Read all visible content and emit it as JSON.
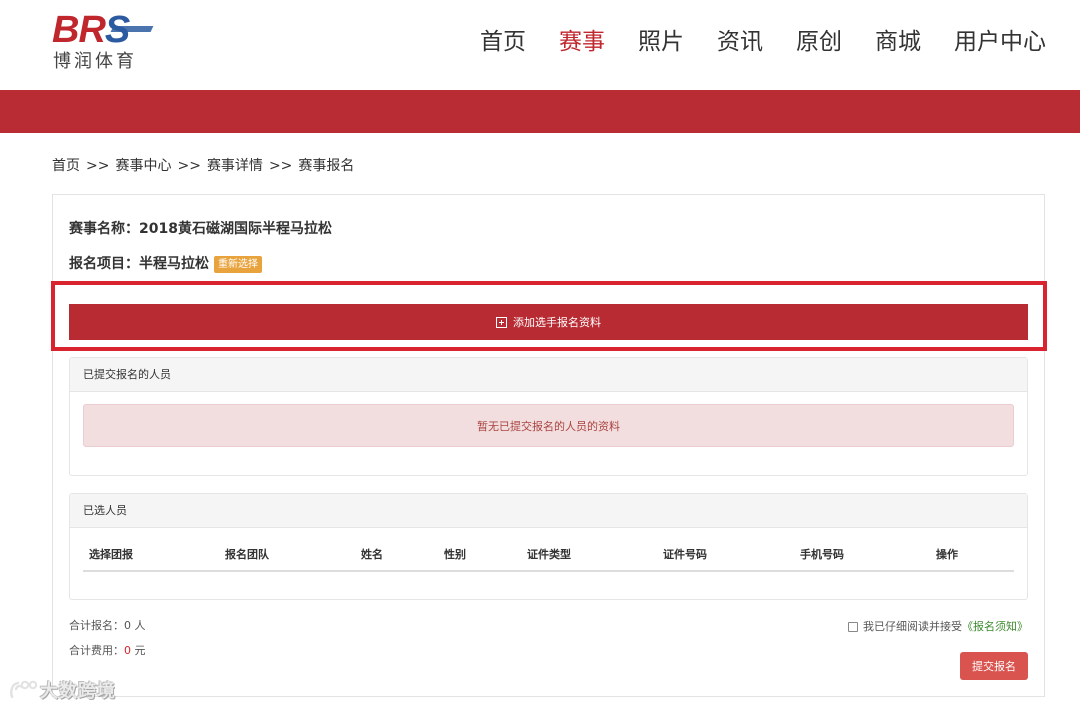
{
  "logo": {
    "letter_b": "B",
    "letter_r": "R",
    "letter_s": "S",
    "subtitle": "博润体育",
    "brand_red": "#c0272d",
    "brand_blue": "#2c5aa0"
  },
  "nav": {
    "items": [
      {
        "label": "首页",
        "active": false
      },
      {
        "label": "赛事",
        "active": true
      },
      {
        "label": "照片",
        "active": false
      },
      {
        "label": "资讯",
        "active": false
      },
      {
        "label": "原创",
        "active": false
      },
      {
        "label": "商城",
        "active": false
      },
      {
        "label": "用户中心",
        "active": false
      }
    ]
  },
  "breadcrumb": {
    "items": [
      "首页",
      "赛事中心",
      "赛事详情",
      "赛事报名"
    ],
    "separator": ">>"
  },
  "event": {
    "name_label": "赛事名称：",
    "name_value": "2018黄石磁湖国际半程马拉松",
    "item_label": "报名项目：",
    "item_value": "半程马拉松",
    "reselect_label": "重新选择"
  },
  "add_button": {
    "label": "添加选手报名资料",
    "icon": "plus-square-icon"
  },
  "submitted_panel": {
    "title": "已提交报名的人员",
    "empty_message": "暂无已提交报名的人员的资料"
  },
  "selected_panel": {
    "title": "已选人员",
    "columns": [
      "选择团报",
      "报名团队",
      "姓名",
      "性别",
      "证件类型",
      "证件号码",
      "手机号码",
      "操作"
    ]
  },
  "totals": {
    "count_label": "合计报名：",
    "count_value": "0",
    "count_unit": " 人",
    "fee_label": "合计费用：",
    "fee_value": "0",
    "fee_unit": " 元"
  },
  "agreement": {
    "text": "我已仔细阅读并接受",
    "link": "《报名须知》",
    "checked": false
  },
  "submit_button": {
    "label": "提交报名"
  },
  "watermark": {
    "text": "大数跨境"
  },
  "colors": {
    "accent": "#ba2c33",
    "highlight": "#d9232e",
    "badge": "#e8a33d",
    "link_green": "#3c8a2e",
    "submit": "#d9534f"
  }
}
